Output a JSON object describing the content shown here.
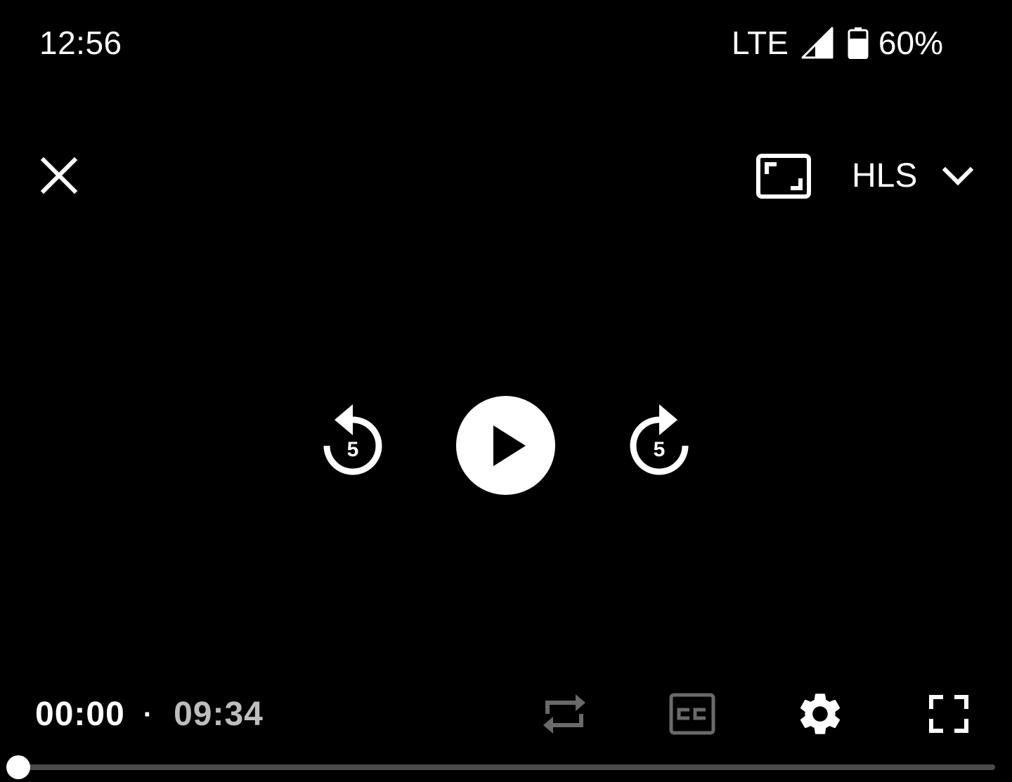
{
  "status_bar": {
    "time": "12:56",
    "network": "LTE",
    "battery": "60%",
    "icons": [
      "signal-icon",
      "battery-icon"
    ]
  },
  "top_controls": {
    "close_icon": "close-icon",
    "aspect_icon": "aspect-ratio-icon",
    "source_label": "HLS",
    "source_icon": "chevron-down-icon"
  },
  "center_controls": {
    "rewind_seconds": "5",
    "forward_seconds": "5",
    "play_icon": "play-icon"
  },
  "bottom_controls": {
    "current_time": "00:00",
    "separator": "·",
    "duration": "09:34",
    "icons": [
      "repeat-icon",
      "closed-captions-icon",
      "gear-icon",
      "fullscreen-icon"
    ]
  },
  "progress": {
    "fraction": 0
  },
  "colors": {
    "background": "#000000",
    "foreground": "#ffffff",
    "muted": "#bdbdbd",
    "disabled_icon": "#6a6a6a",
    "track": "#4a4a4a"
  }
}
